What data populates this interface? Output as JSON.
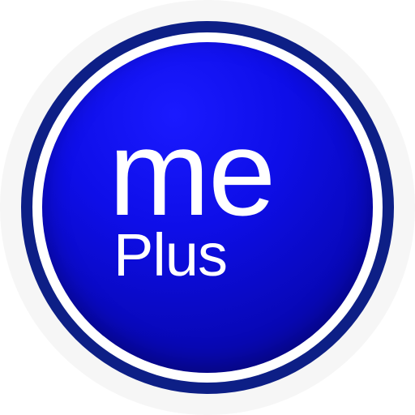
{
  "logo": {
    "word_top": "me",
    "word_bottom": "Plus"
  },
  "colors": {
    "halo": "#f6f6f6",
    "outer_ring": "#0d1f86",
    "inner_ring": "#ffffff",
    "disc_light": "#1a1aff",
    "disc_dark": "#070790",
    "text": "#ffffff"
  }
}
